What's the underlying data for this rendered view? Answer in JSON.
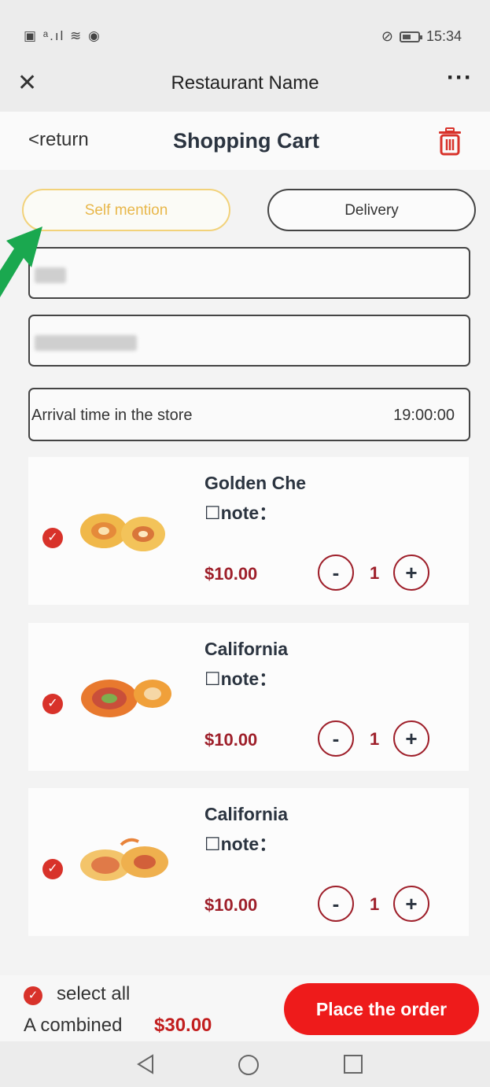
{
  "status_bar": {
    "left_icons": "▣ ᵃ.ıl ≋ ◉",
    "time": "15:34"
  },
  "app_bar": {
    "close_glyph": "✕",
    "title": "Restaurant Name",
    "more_glyph": "···"
  },
  "cart_bar": {
    "back_label": "<return",
    "title": "Shopping Cart",
    "trash_icon": "trash-icon"
  },
  "tabs": [
    {
      "label": "Self mention",
      "selected": true
    },
    {
      "label": "Delivery",
      "selected": false
    }
  ],
  "arrival": {
    "label": "Arrival time in the store",
    "value": "19:00:00"
  },
  "items": [
    {
      "name": "Golden Che",
      "note": "☐note：",
      "price": "$10.00",
      "qty": "1"
    },
    {
      "name": "California",
      "note": "☐note：",
      "price": "$10.00",
      "qty": "1"
    },
    {
      "name": "California",
      "note": "☐note：",
      "price": "$10.00",
      "qty": "1"
    }
  ],
  "stepper": {
    "minus": "-",
    "plus": "+"
  },
  "footer": {
    "select_all": "select all",
    "combined_label": "A combined",
    "total": "$30.00",
    "order_button": "Place the order"
  },
  "colors": {
    "accent": "#9e1f2a",
    "order_button": "#ee1b1b",
    "check": "#d8322a",
    "self_tab": "#f2d27a",
    "arrow": "#1aa84f"
  }
}
